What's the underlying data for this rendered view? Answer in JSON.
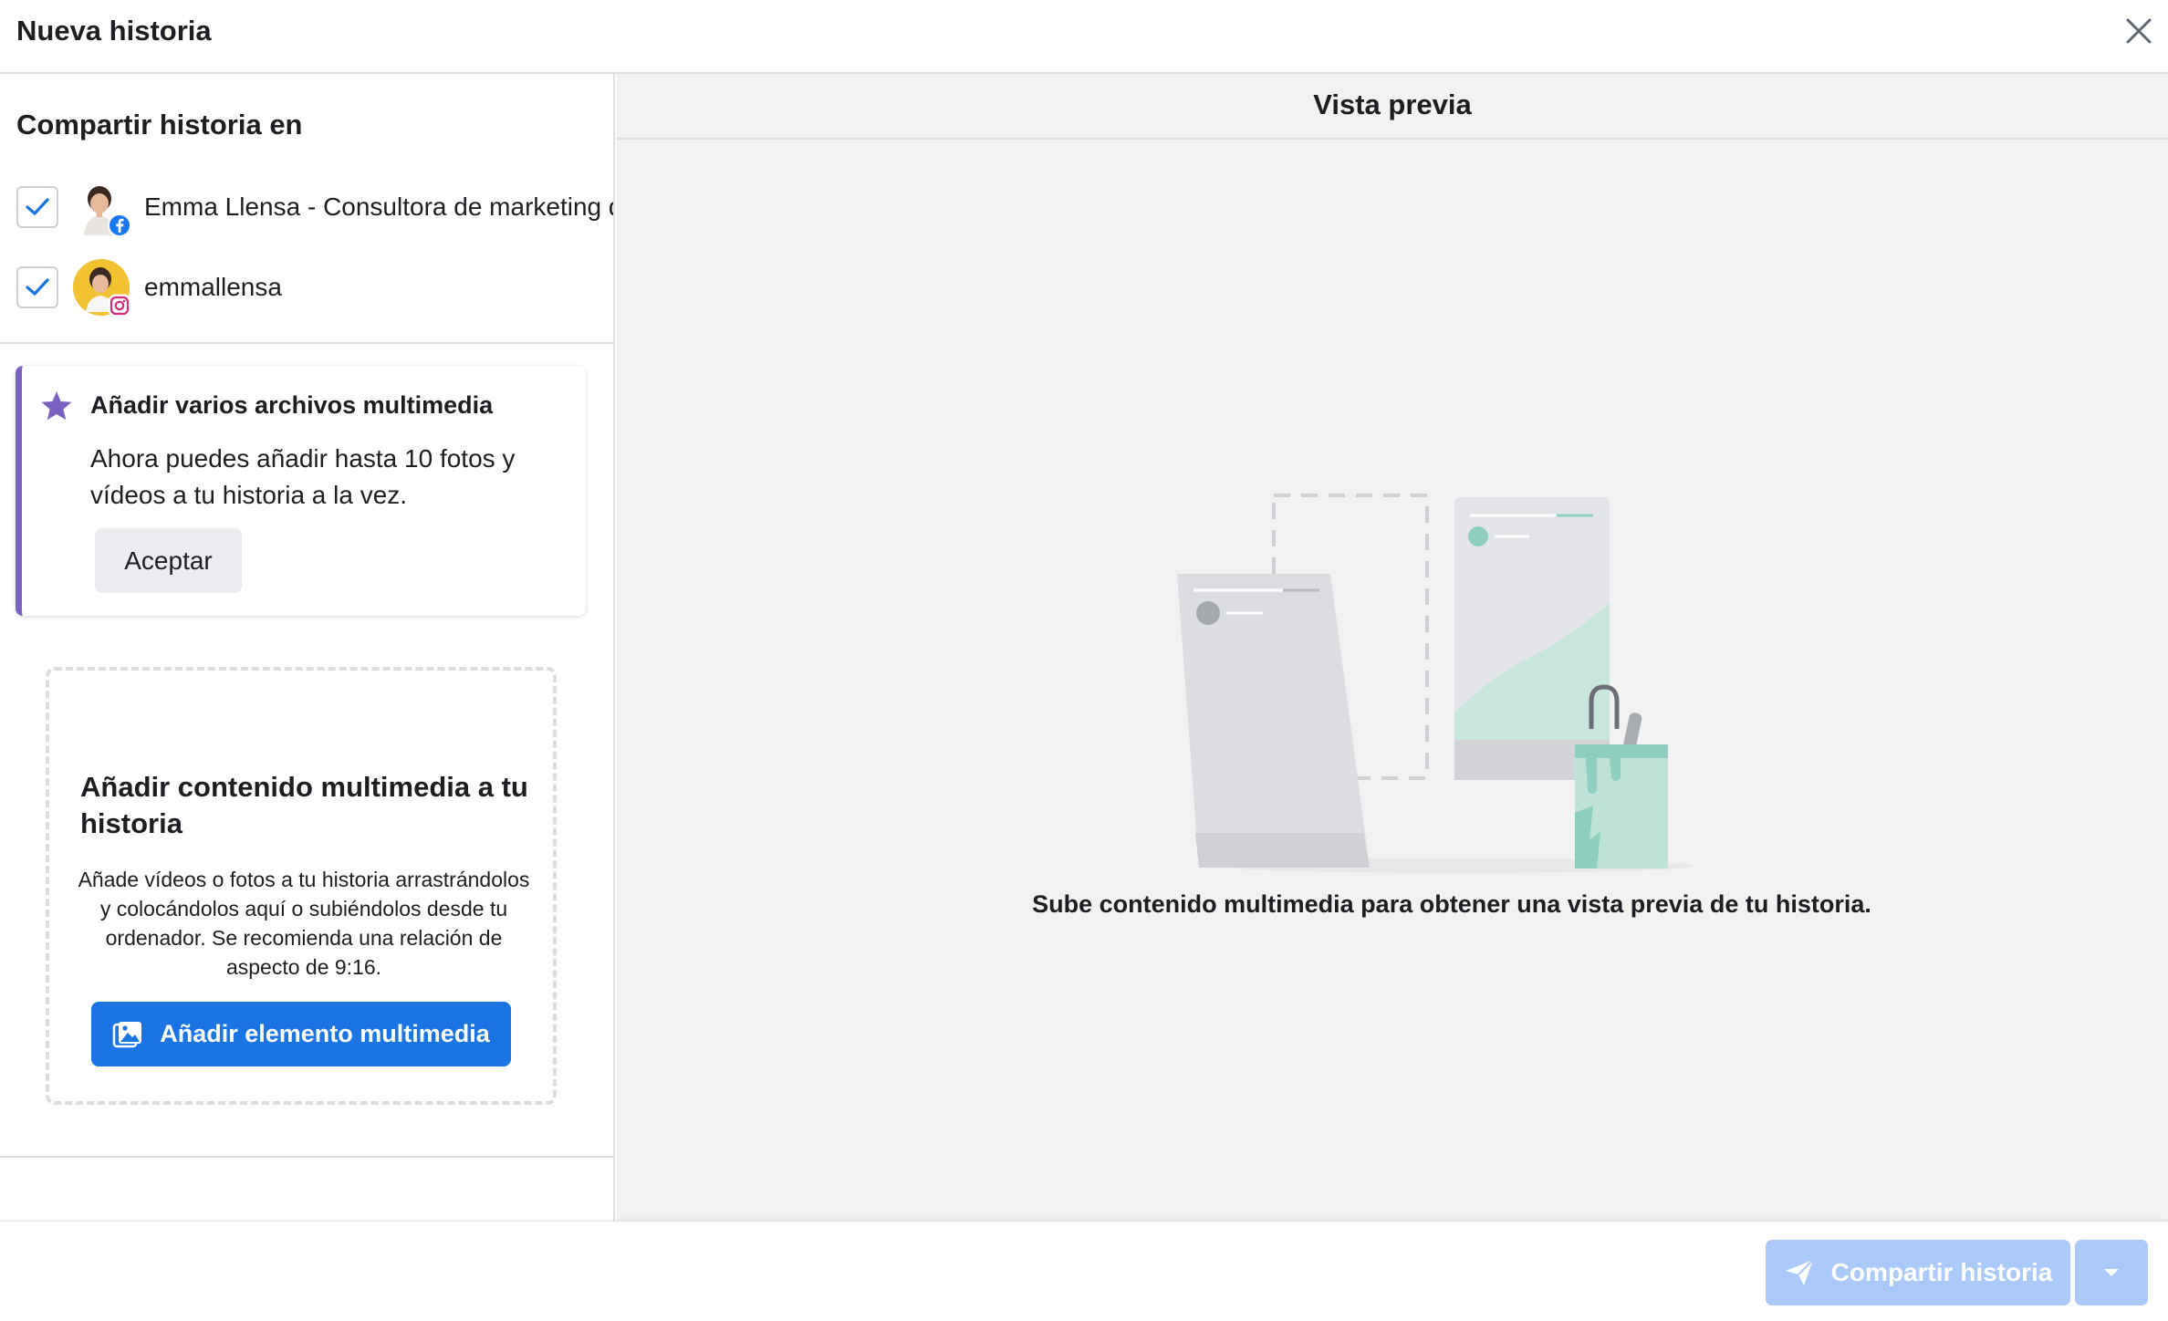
{
  "header": {
    "title": "Nueva historia"
  },
  "share": {
    "heading": "Compartir historia en",
    "accounts": [
      {
        "name": "Emma Llensa - Consultora de marketing d",
        "platform": "facebook",
        "checked": true
      },
      {
        "name": "emmallensa",
        "platform": "instagram",
        "checked": true
      }
    ]
  },
  "tip": {
    "title": "Añadir varios archivos multimedia",
    "text": "Ahora puedes añadir hasta 10 fotos y vídeos a tu historia a la vez.",
    "button": "Aceptar",
    "icon": "star-icon",
    "accent": "#7b61c2"
  },
  "dropzone": {
    "title": "Añadir contenido multimedia a tu historia",
    "text": "Añade vídeos o fotos a tu historia arrastrándolos y colocándolos aquí o subiéndolos desde tu ordenador. Se recomienda una relación de aspecto de 9:16.",
    "button": "Añadir elemento multimedia",
    "button_color": "#1b74e4"
  },
  "preview": {
    "title": "Vista previa",
    "message": "Sube contenido multimedia para obtener una vista previa de tu historia."
  },
  "footer": {
    "share_button": "Compartir historia",
    "share_button_color": "#aac9f8"
  }
}
